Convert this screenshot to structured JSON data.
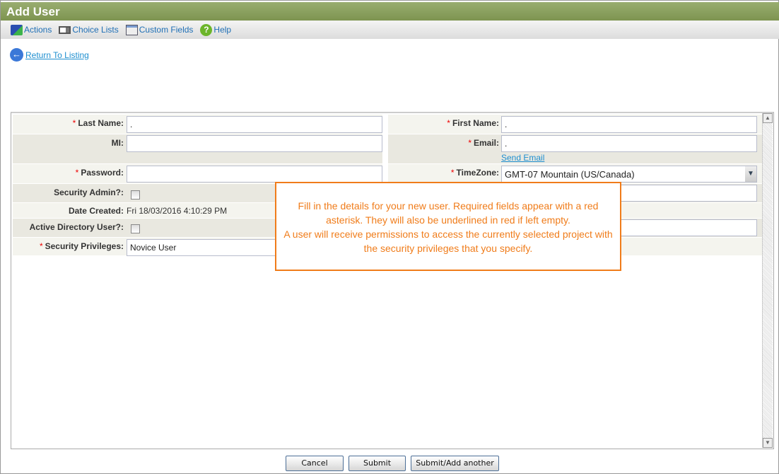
{
  "title": "Add User",
  "toolbar": {
    "actions": "Actions",
    "choice_lists": "Choice Lists",
    "custom_fields": "Custom Fields",
    "help": "Help"
  },
  "return_link": "Return To Listing",
  "form": {
    "last_name": {
      "label": "Last Name:",
      "value": "."
    },
    "first_name": {
      "label": "First Name:",
      "value": "."
    },
    "mi": {
      "label": "MI:",
      "value": ""
    },
    "email": {
      "label": "Email:",
      "value": ".",
      "send_email": "Send Email"
    },
    "password": {
      "label": "Password:",
      "value": ""
    },
    "timezone": {
      "label": "TimeZone:",
      "value": "GMT-07 Mountain (US/Canada)"
    },
    "security_admin": {
      "label": "Security Admin?:",
      "checked": false
    },
    "date_created": {
      "label": "Date Created:",
      "value": "Fri 18/03/2016 4:10:29 PM"
    },
    "ad_user": {
      "label": "Active Directory User?:",
      "checked": false
    },
    "security_privileges": {
      "label": "Security Privileges:",
      "value": "Novice User"
    },
    "required_mark": "*"
  },
  "tooltip": {
    "line1": "Fill in the details for your new user. Required fields appear with a red asterisk. They will also be underlined in red if left empty.",
    "line2": "A user will receive permissions to access the currently selected project with the security privileges that you specify."
  },
  "buttons": {
    "cancel": "Cancel",
    "submit": "Submit",
    "submit_add": "Submit/Add another"
  }
}
